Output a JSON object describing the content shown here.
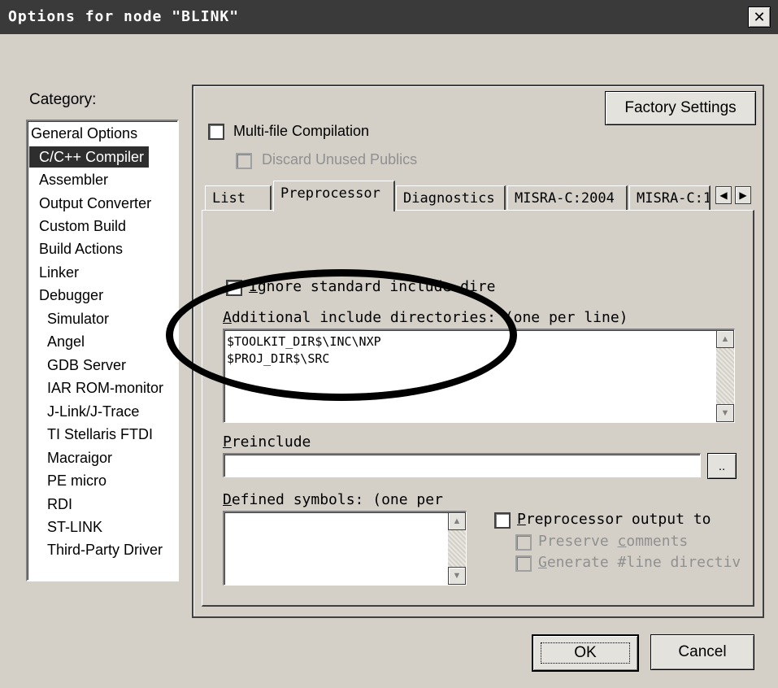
{
  "window": {
    "title": "Options for node \"BLINK\"",
    "close_glyph": "✕"
  },
  "category": {
    "label": "Category:",
    "items": [
      {
        "label": "General Options",
        "selected": false
      },
      {
        "label": "C/C++ Compiler",
        "selected": true
      },
      {
        "label": "Assembler",
        "selected": false
      },
      {
        "label": "Output Converter",
        "selected": false
      },
      {
        "label": "Custom Build",
        "selected": false
      },
      {
        "label": "Build Actions",
        "selected": false
      },
      {
        "label": "Linker",
        "selected": false
      },
      {
        "label": "Debugger",
        "selected": false
      },
      {
        "label": "Simulator",
        "selected": false
      },
      {
        "label": "Angel",
        "selected": false
      },
      {
        "label": "GDB Server",
        "selected": false
      },
      {
        "label": "IAR ROM-monitor",
        "selected": false
      },
      {
        "label": "J-Link/J-Trace",
        "selected": false
      },
      {
        "label": "TI Stellaris FTDI",
        "selected": false
      },
      {
        "label": "Macraigor",
        "selected": false
      },
      {
        "label": "PE micro",
        "selected": false
      },
      {
        "label": "RDI",
        "selected": false
      },
      {
        "label": "ST-LINK",
        "selected": false
      },
      {
        "label": "Third-Party Driver",
        "selected": false
      }
    ]
  },
  "panel": {
    "factory_settings": "Factory Settings",
    "multi_file": {
      "label": "Multi-file Compilation",
      "checked": false
    },
    "discard_unused": {
      "label": "Discard Unused Publics",
      "checked": false,
      "disabled": true
    }
  },
  "tabs": [
    {
      "label": "List",
      "active": false
    },
    {
      "label": "Preprocessor",
      "active": true
    },
    {
      "label": "Diagnostics",
      "active": false
    },
    {
      "label": "MISRA-C:2004",
      "active": false
    },
    {
      "label": "MISRA-C:1",
      "active": false
    }
  ],
  "tab_scroll": {
    "left": "◀",
    "right": "▶"
  },
  "preprocessor": {
    "ignore_std": {
      "accel": "I",
      "label_rest": "gnore standard include dire",
      "checked": false
    },
    "additional_dirs": {
      "label_accel": "A",
      "label_rest": "dditional include directories: (one per line)",
      "lines": [
        "$TOOLKIT_DIR$\\INC\\NXP",
        "$PROJ_DIR$\\SRC"
      ]
    },
    "preinclude": {
      "accel": "P",
      "label_rest": "reinclude",
      "value": "",
      "browse": ".."
    },
    "defined_symbols": {
      "accel": "D",
      "label_rest": "efined symbols: (one per",
      "value": ""
    },
    "pp_output": {
      "accel": "P",
      "label_rest": "reprocessor output to",
      "checked": false
    },
    "preserve_comments": {
      "label_a": "Preserve ",
      "accel": "c",
      "label_b": "omments",
      "checked": false,
      "disabled": true
    },
    "generate_line": {
      "accel": "G",
      "label_rest": "enerate #line directiv",
      "checked": false,
      "disabled": true
    }
  },
  "scroll_arrows": {
    "up": "▲",
    "down": "▼"
  },
  "buttons": {
    "ok": "OK",
    "cancel": "Cancel"
  }
}
